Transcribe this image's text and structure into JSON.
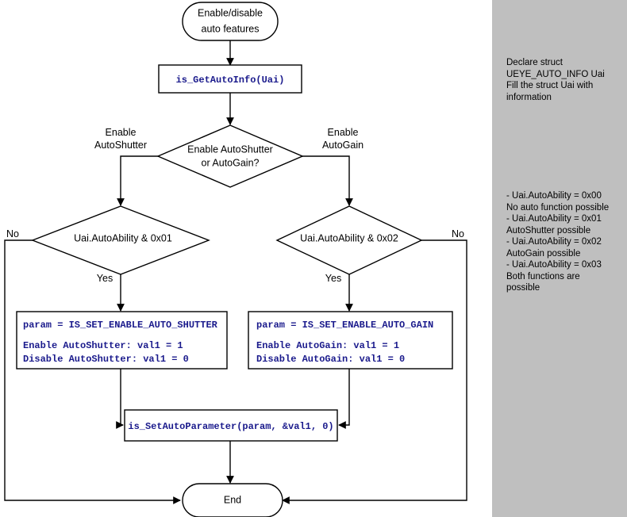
{
  "diagram": {
    "title_node": "Enable/disable\nauto features",
    "nodes": {
      "start": {
        "label": "Enable/disable auto features",
        "line1": "Enable/disable",
        "line2": "auto features"
      },
      "get_auto_info": {
        "label": "is_GetAutoInfo(Uai)"
      },
      "decision_main": {
        "line1": "Enable AutoShutter",
        "line2": "or AutoGain?"
      },
      "decision_shutter": {
        "label": "Uai.AutoAbility & 0x01"
      },
      "decision_gain": {
        "label": "Uai.AutoAbility & 0x02"
      },
      "box_shutter": {
        "line1": "param = IS_SET_ENABLE_AUTO_SHUTTER",
        "line2": "Enable AutoShutter: val1 = 1",
        "line3": "Disable AutoShutter: val1 = 0"
      },
      "box_gain": {
        "line1": "param = IS_SET_ENABLE_AUTO_GAIN",
        "line2": "Enable AutoGain: val1 = 1",
        "line3": "Disable AutoGain: val1 = 0"
      },
      "set_auto_parameter": {
        "label": "is_SetAutoParameter(param, &val1, 0)"
      },
      "end": {
        "label": "End"
      }
    },
    "edge_labels": {
      "branch_shutter_line1": "Enable",
      "branch_shutter_line2": "AutoShutter",
      "branch_gain_line1": "Enable",
      "branch_gain_line2": "AutoGain",
      "shutter_no": "No",
      "shutter_yes": "Yes",
      "gain_no": "No",
      "gain_yes": "Yes"
    }
  },
  "side_panel": {
    "background_color": "#bfbfbf",
    "declare_note": "Declare struct UEYE_AUTO_INFO Uai\nFill the struct Uai with information",
    "ability_note": "- Uai.AutoAbility = 0x00\n  No auto function possible\n- Uai.AutoAbility = 0x01\n  AutoShutter possible\n- Uai.AutoAbility = 0x02\n  AutoGain possible\n- Uai.AutoAbility = 0x03\n  Both functions are\n  possible"
  },
  "colors": {
    "code_text": "#1a1a8c",
    "node_stroke": "#000000",
    "node_fill": "#ffffff",
    "panel": "#bfbfbf"
  }
}
